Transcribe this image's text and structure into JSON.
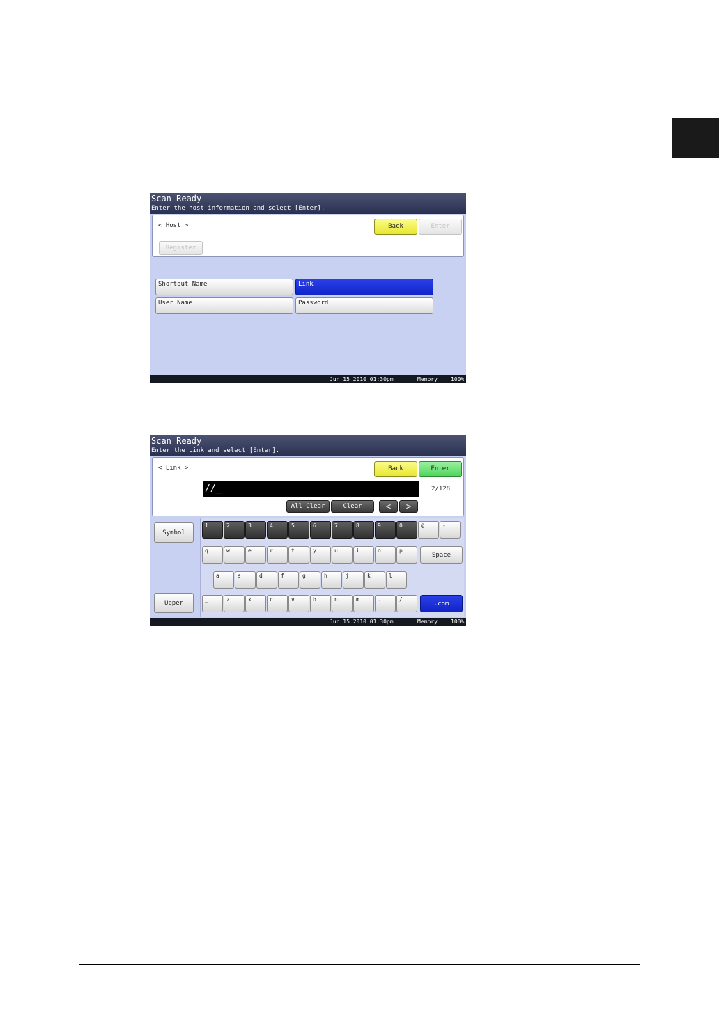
{
  "screen1": {
    "title": "Scan Ready",
    "instruction": "Enter the host information and select [Enter].",
    "breadcrumb": "< Host >",
    "back_label": "Back",
    "enter_label": "Enter",
    "register_label": "Register",
    "fields": [
      "Shortout Name",
      "Link",
      "User Name",
      "Password"
    ],
    "status": {
      "datetime": "Jun 15 2010 01:30pm",
      "memory_label": "Memory",
      "memory_value": "100%"
    }
  },
  "screen2": {
    "title": "Scan Ready",
    "instruction": "Enter the Link and select [Enter].",
    "breadcrumb": "< Link >",
    "back_label": "Back",
    "enter_label": "Enter",
    "input_value": "//_",
    "char_count": "2/128",
    "all_clear_label": "All Clear",
    "clear_label": "Clear",
    "left_arrow": "<",
    "right_arrow": ">",
    "symbol_label": "Symbol",
    "upper_label": "Upper",
    "space_label": "Space",
    "dotcom_label": ".com",
    "keys": {
      "row1": [
        "1",
        "2",
        "3",
        "4",
        "5",
        "6",
        "7",
        "8",
        "9",
        "0",
        "@",
        "-"
      ],
      "row2": [
        "q",
        "w",
        "e",
        "r",
        "t",
        "y",
        "u",
        "i",
        "o",
        "p"
      ],
      "row3": [
        "a",
        "s",
        "d",
        "f",
        "g",
        "h",
        "j",
        "k",
        "l"
      ],
      "row4": [
        "_",
        "z",
        "x",
        "c",
        "v",
        "b",
        "n",
        "m",
        ".",
        "/"
      ]
    },
    "status": {
      "datetime": "Jun 15 2010 01:30pm",
      "memory_label": "Memory",
      "memory_value": "100%"
    }
  }
}
